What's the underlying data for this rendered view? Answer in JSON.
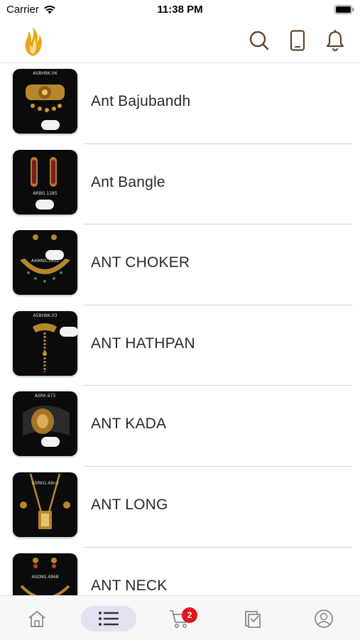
{
  "status_bar": {
    "carrier": "Carrier",
    "time": "11:38 PM"
  },
  "header": {
    "logo_icon": "flame-logo-icon",
    "icons": [
      "search-icon",
      "phone-icon",
      "bell-icon"
    ],
    "accent_color": "#5a4632",
    "logo_color": "#e6a817"
  },
  "categories": [
    {
      "label": "Ant  Bajubandh",
      "code": "ASBHBK.06"
    },
    {
      "label": "Ant Bangle",
      "code": "ARBG.1285"
    },
    {
      "label": "ANT CHOKER",
      "code": "AAMNS.3902"
    },
    {
      "label": "ANT HATHPAN",
      "code": "ASBHBK.03"
    },
    {
      "label": "ANT KADA",
      "code": "ASRK.673"
    },
    {
      "label": "ANT LONG",
      "code": "ASRKG.48n3"
    },
    {
      "label": "ANT NECK",
      "code": "ASDNS.4868"
    }
  ],
  "tab_bar": {
    "tabs": [
      "home-icon",
      "list-icon",
      "cart-icon",
      "catalog-icon",
      "profile-icon"
    ],
    "active_tab": "list-icon",
    "cart_count": "2",
    "badge_color": "#e3141d",
    "active_bg": "#e6e0f3"
  }
}
